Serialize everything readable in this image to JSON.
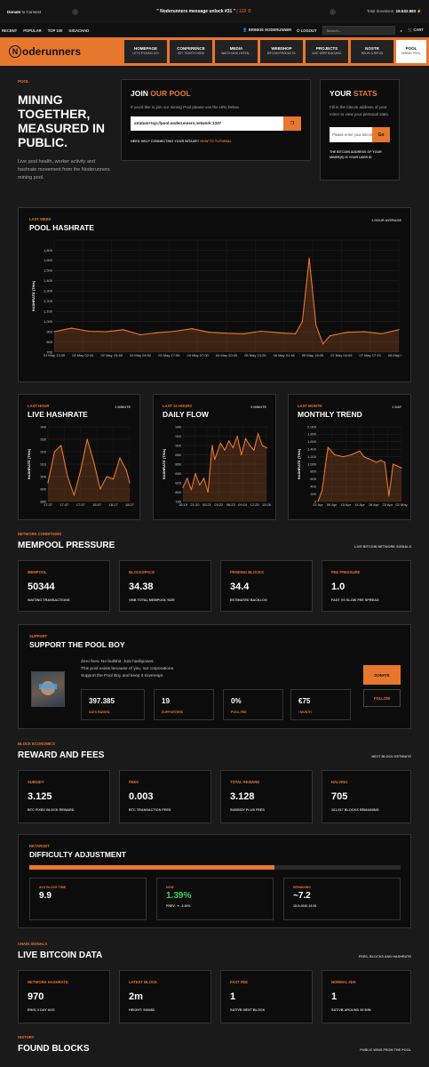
{
  "topbar": {
    "donate": "Donate",
    "donate_rest": "to Connect",
    "message": "\" Noderunners message unlock #31 \"",
    "message_tag": "| 122 ⏱",
    "total_label": "Total donations:",
    "total_value": "19.532.983 ⚡"
  },
  "menu": {
    "items": [
      "RECENT",
      "POPULAR",
      "TOP 100",
      "GIGACHAD"
    ],
    "user": "BRINKIE NODERUNNER",
    "logout": "LOGOUT",
    "search_placeholder": "Search...",
    "cart": "CART"
  },
  "header": {
    "logo": "oderunners",
    "logo_n": "N",
    "nav": [
      {
        "a": "HOMEPAGE",
        "b": "LET'S F*CKING GO!"
      },
      {
        "a": "CONFERENCE",
        "b": "GET TICKETS NOW!"
      },
      {
        "a": "MEDIA",
        "b": "WATCH AND LISTEN..."
      },
      {
        "a": "WEBSHOP",
        "b": "BITCOIN PRODUCTS."
      },
      {
        "a": "PROJECTS",
        "b": "JUST KEEP BUILDING."
      },
      {
        "a": "NOSTR",
        "b": "RELAY & RIP-05"
      },
      {
        "a": "POOL",
        "b": "MINING POOL"
      }
    ]
  },
  "intro": {
    "kicker": "POOL",
    "title": "MINING TOGETHER, MEASURED IN PUBLIC.",
    "desc": "Live pool health, worker activity and hashrate movement from the Noderunners mining pool."
  },
  "join": {
    "title_a": "JOIN ",
    "title_b": "OUR POOL",
    "text": "If you'd like to join our mining Pool please use the URL below.",
    "url": "stratum+tcp://pool.noderunners.network:1337",
    "help_a": "NEED HELP CONNECTING YOUR BITAXE? ",
    "help_b": "HOW TO TUTORIAL"
  },
  "stats": {
    "title_a": "YOUR ",
    "title_b": "STATS",
    "text": "Fill in the bitcoin address of your miner to view your personal stats.",
    "placeholder": "Please enter your bitcoin",
    "go": "Go",
    "help": "THE BITCOIN ADDRESS OF YOUR MINER(S) IS YOUR USER ID"
  },
  "hashrate": {
    "kicker": "LAST WEEK",
    "title": "POOL HASHRATE",
    "right": "1 HOUR AVERAGE",
    "ylabel": "HASHRATE (TH/s)"
  },
  "live": {
    "kicker": "LAST HOUR",
    "title": "LIVE HASHRATE",
    "right": "1 MINUTE",
    "ylabel": "HASHRATE (TH/s)"
  },
  "daily": {
    "kicker": "LAST 24 HOURS",
    "title": "DAILY FLOW",
    "right": "5 MINUTE",
    "ylabel": "HASHRATE (TH/s)"
  },
  "monthly": {
    "kicker": "LAST MONTH",
    "title": "MONTHLY TREND",
    "right": "1 DAY",
    "ylabel": "HASHRATE (TH/s)"
  },
  "mempool": {
    "kicker": "NETWORK CONDITIONS",
    "title": "MEMPOOL PRESSURE",
    "right": "LIVE BITCOIN NETWORK SIGNALS",
    "cards": [
      {
        "k": "MEMPOOL",
        "v": "50344",
        "s": "WAITING TRANSACTIONS"
      },
      {
        "k": "BLOCKSPACE",
        "v": "34.38",
        "s": "VMB TOTAL MEMPOOL SIZE"
      },
      {
        "k": "PENDING BLOCKS",
        "v": "34.4",
        "s": "ESTIMATED BACKLOG"
      },
      {
        "k": "FEE PRESSURE",
        "v": "1.0",
        "s": "FAST VS SLOW FEE SPREAD"
      }
    ]
  },
  "support": {
    "kicker": "SUPPORT",
    "title": "SUPPORT THE POOL BOY",
    "lines": [
      "Zero fees. No bullshit. Just hashpower.",
      "This pool exists because of you, not corporations.",
      "Support the Pool Boy and keep it sovereign."
    ],
    "donate": "DONATE",
    "follow": "FOLLOW",
    "cards": [
      {
        "v": "397.385",
        "s": "SATS RAISED"
      },
      {
        "v": "19",
        "s": "SUPPORTERS"
      },
      {
        "v": "0%",
        "s": "POOL FEE"
      },
      {
        "v": "€75",
        "s": "/ MONTH"
      }
    ]
  },
  "reward": {
    "kicker": "BLOCK ECONOMICS",
    "title": "REWARD AND FEES",
    "right": "NEXT BLOCK ESTIMATE",
    "cards": [
      {
        "k": "SUBSIDY",
        "v": "3.125",
        "s": "BTC FIXED BLOCK REWARD"
      },
      {
        "k": "FEES",
        "v": "0.003",
        "s": "BTC TRANSACTION FEES"
      },
      {
        "k": "TOTAL REWARD",
        "v": "3.128",
        "s": "SUBSIDY PLUS FEES"
      },
      {
        "k": "HALVING",
        "v": "705",
        "s": "161,517 BLOCKS REMAINING"
      }
    ]
  },
  "difficulty": {
    "kicker": "RETARGET",
    "title": "DIFFICULTY ADJUSTMENT",
    "progress": 0.66,
    "cards": [
      {
        "k": "AVG BLOCK TIME",
        "v": "9.9",
        "s": ""
      },
      {
        "k": "NOW",
        "v": "1.39%",
        "s": "PREV: ▼ -2.30%"
      },
      {
        "k": "REMAINING",
        "v": "~7.2",
        "s": "15-5-2026 23:51"
      }
    ]
  },
  "chain": {
    "kicker": "CHAIN SIGNALS",
    "title": "LIVE BITCOIN DATA",
    "right": "FEES, BLOCKS AND HASHRATE",
    "cards": [
      {
        "k": "NETWORK HASHRATE",
        "v": "970",
        "s": "EH/S, 3 DAY AVG"
      },
      {
        "k": "LATEST BLOCK",
        "v": "2m",
        "s": "HEIGHT: 948483"
      },
      {
        "k": "FAST FEE",
        "v": "1",
        "s": "SAT/VB NEXT BLOCK"
      },
      {
        "k": "NORMAL FEE",
        "v": "1",
        "s": "SAT/VB AROUND 30 MIN"
      }
    ]
  },
  "found": {
    "kicker": "HISTORY",
    "title": "FOUND BLOCKS",
    "right": "PUBLIC WINS FROM THE POOL"
  },
  "colors": {
    "accent": "#e8772e",
    "good": "#39d353"
  },
  "chart_data": [
    {
      "type": "line",
      "title": "POOL HASHRATE",
      "ylabel": "HASHRATE (TH/s)",
      "ylim": [
        700,
        1800
      ],
      "yticks": [
        700,
        800,
        900,
        1000,
        1100,
        1200,
        1300,
        1400,
        1500,
        1600,
        1700,
        1800
      ],
      "ytick_labels": [
        "700",
        "800",
        "900",
        "1,000",
        "1,100",
        "1,200",
        "1,300",
        "1,400",
        "1,500",
        "1,600",
        "1,800"
      ],
      "xticks": [
        "01 May 13:39",
        "02 May 02:44",
        "02 May 15:48",
        "03 May 04:52",
        "03 May 17:56",
        "04 May 07:00",
        "04 May 20:05",
        "05 May 13:26",
        "06 May 01:46",
        "06 May 15:05",
        "07 May 04:09",
        "07 May 17:15",
        "08 May 06:23"
      ],
      "x": [
        0,
        5,
        10,
        15,
        20,
        25,
        30,
        35,
        40,
        45,
        50,
        55,
        60,
        65,
        70,
        72,
        74,
        76,
        78,
        80,
        85,
        90,
        95,
        100
      ],
      "values": [
        900,
        935,
        905,
        900,
        920,
        870,
        890,
        905,
        930,
        895,
        885,
        880,
        905,
        890,
        880,
        1000,
        1620,
        960,
        780,
        860,
        895,
        900,
        880,
        920
      ]
    },
    {
      "type": "line",
      "title": "LIVE HASHRATE",
      "ylabel": "HASHRATE (TH/s)",
      "ylim": [
        880,
        940
      ],
      "yticks": [
        880,
        890,
        900,
        910,
        920,
        930,
        940
      ],
      "xticks": [
        "17:37",
        "17:47",
        "17:57",
        "18:07",
        "18:17",
        "18:27"
      ],
      "x": [
        0,
        8,
        16,
        24,
        32,
        40,
        48,
        56,
        64,
        72,
        80,
        88,
        96,
        100
      ],
      "values": [
        895,
        920,
        925,
        900,
        885,
        905,
        930,
        912,
        890,
        900,
        898,
        915,
        905,
        895
      ]
    },
    {
      "type": "line",
      "title": "DAILY FLOW",
      "ylabel": "HASHRATE (TH/s)",
      "ylim": [
        780,
        940
      ],
      "yticks": [
        780,
        800,
        820,
        840,
        860,
        880,
        900,
        920,
        940
      ],
      "xticks": [
        "18:19",
        "21:20",
        "00:21",
        "03:22",
        "06:23",
        "09:24",
        "12:25",
        "15:26"
      ],
      "x": [
        0,
        5,
        10,
        15,
        20,
        25,
        30,
        35,
        38,
        40,
        45,
        50,
        55,
        60,
        65,
        70,
        75,
        80,
        85,
        90,
        95,
        100
      ],
      "values": [
        810,
        830,
        805,
        840,
        815,
        830,
        800,
        900,
        870,
        880,
        905,
        890,
        910,
        895,
        920,
        880,
        915,
        900,
        890,
        925,
        900,
        895
      ]
    },
    {
      "type": "line",
      "title": "MONTHLY TREND",
      "ylabel": "HASHRATE (TH/s)",
      "ylim": [
        0,
        2000
      ],
      "yticks": [
        0,
        200,
        400,
        600,
        800,
        1000,
        1200,
        1400,
        1600,
        1800,
        2000
      ],
      "ytick_labels": [
        "0",
        "200",
        "400",
        "600",
        "800",
        "1,000",
        "1,200",
        "1,400",
        "1,600",
        "1,800",
        "2,000"
      ],
      "xticks": [
        "02 Apr",
        "06 Apr",
        "10 Apr",
        "14 Apr",
        "18 Apr",
        "22 Apr",
        "02 May"
      ],
      "x": [
        0,
        5,
        10,
        12,
        20,
        30,
        40,
        50,
        55,
        60,
        65,
        70,
        75,
        80,
        85,
        90,
        95,
        100
      ],
      "values": [
        0,
        300,
        1150,
        1450,
        1250,
        1200,
        1250,
        1350,
        1200,
        1150,
        1100,
        1050,
        1100,
        1050,
        150,
        1000,
        950,
        900
      ]
    }
  ]
}
